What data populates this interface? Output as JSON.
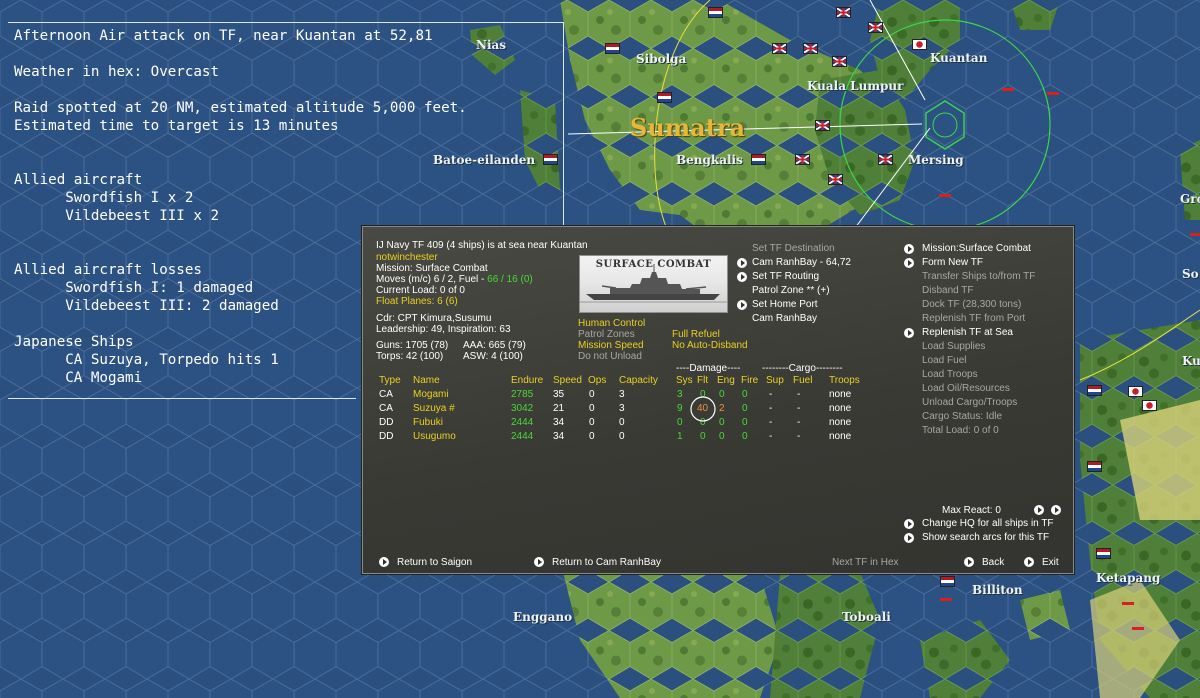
{
  "map": {
    "labels": {
      "nias": "Nias",
      "sibolga": "Sibolga",
      "kuala_lumpur": "Kuala Lumpur",
      "kuantan": "Kuantan",
      "sumatra": "Sumatra",
      "batoe_eilanden": "Batoe-eilanden",
      "bengkalis": "Bengkalis",
      "mersing": "Mersing",
      "gro": "Gro",
      "so": "So",
      "ku": "Ku",
      "enggano": "Enggano",
      "toboali": "Toboali",
      "billiton": "Billiton",
      "ketapang": "Ketapang"
    }
  },
  "combat_report": {
    "lines": [
      "Afternoon Air attack on TF, near Kuantan at 52,81",
      "Weather in hex: Overcast",
      "Raid spotted at 20 NM, estimated altitude 5,000 feet.",
      "Estimated time to target is 13 minutes",
      "Allied aircraft",
      "      Swordfish I x 2",
      "      Vildebeest III x 2",
      "Allied aircraft losses",
      "      Swordfish I: 1 damaged",
      "      Vildebeest III: 2 damaged",
      "Japanese Ships",
      "      CA Suzuya, Torpedo hits 1",
      "      CA Mogami"
    ]
  },
  "tf": {
    "header": "IJ Navy TF 409 (4 ships) is at sea near Kuantan",
    "player": "notwinchester",
    "mission": "Mission: Surface Combat",
    "moves_prefix": "Moves (m/c) 6 / 2, Fuel - ",
    "fuel": "66 / 16 (0)",
    "current_load": "Current Load: 0 of 0",
    "float_planes": "Float Planes: 6 (6)",
    "cdr": "Cdr: CPT Kimura,Susumu",
    "leadership": "Leadership: 49, Inspiration: 63",
    "guns": "Guns: 1705 (78)",
    "aaa": "AAA: 665 (79)",
    "torps": "Torps: 42 (100)",
    "asw": "ASW: 4 (100)",
    "image_caption": "SURFACE COMBAT",
    "human_control": "Human Control",
    "patrol_zones": "Patrol Zones",
    "full_refuel": "Full Refuel",
    "mission_speed": "Mission Speed",
    "no_auto_disband": "No Auto-Disband",
    "do_not_unload": "Do not Unload",
    "mid_options": {
      "set_tf_destination": "Set TF Destination",
      "cam_ranh_bay_dest": "Cam RanhBay - 64,72",
      "set_tf_routing": "Set TF Routing",
      "patrol_zone": "Patrol Zone ** (+)",
      "set_home_port": "Set Home Port",
      "cam_ranh_bay_home": "Cam RanhBay"
    },
    "right_options": {
      "mission_surface_combat": "Mission:Surface Combat",
      "form_new_tf": "Form New TF",
      "transfer_ships": "Transfer Ships to/from TF",
      "disband_tf": "Disband TF",
      "dock_tf": "Dock TF (28,300 tons)",
      "replenish_port": "Replenish TF from Port",
      "replenish_sea": "Replenish TF at Sea",
      "load_supplies": "Load Supplies",
      "load_fuel": "Load Fuel",
      "load_troops": "Load Troops",
      "load_oil": "Load Oil/Resources",
      "unload_cargo": "Unload Cargo/Troops",
      "cargo_status": "Cargo Status: Idle",
      "total_load": "Total Load: 0 of 0"
    },
    "group_headers": {
      "damage": "----Damage----",
      "cargo": "--------Cargo--------"
    },
    "columns": [
      "Type",
      "Name",
      "Endure",
      "Speed",
      "Ops",
      "Capacity",
      "Sys",
      "Flt",
      "Eng",
      "Fire",
      "Sup",
      "Fuel",
      "Troops"
    ],
    "ships": [
      {
        "type": "CA",
        "name": "Mogami",
        "endure": "2785",
        "speed": "35",
        "ops": "0",
        "capacity": "3",
        "sys": "3",
        "flt": "0",
        "eng": "0",
        "fire": "0",
        "sup": "-",
        "fuel": "-",
        "troops": "none"
      },
      {
        "type": "CA",
        "name": "Suzuya #",
        "endure": "3042",
        "speed": "21",
        "ops": "0",
        "capacity": "3",
        "sys": "9",
        "flt": "40",
        "eng": "2",
        "fire": "0",
        "sup": "-",
        "fuel": "-",
        "troops": "none"
      },
      {
        "type": "DD",
        "name": "Fubuki",
        "endure": "2444",
        "speed": "34",
        "ops": "0",
        "capacity": "0",
        "sys": "0",
        "flt": "0",
        "eng": "0",
        "fire": "0",
        "sup": "-",
        "fuel": "-",
        "troops": "none"
      },
      {
        "type": "DD",
        "name": "Usugumo",
        "endure": "2444",
        "speed": "34",
        "ops": "0",
        "capacity": "0",
        "sys": "1",
        "flt": "0",
        "eng": "0",
        "fire": "0",
        "sup": "-",
        "fuel": "-",
        "troops": "none"
      }
    ],
    "max_react": "Max React: 0",
    "change_hq": "Change HQ for all ships in TF",
    "show_search_arcs": "Show search arcs for this TF",
    "footer": {
      "return_saigon": "Return to Saigon",
      "return_cam_ranh": "Return to Cam RanhBay",
      "next_tf": "Next TF in Hex",
      "back": "Back",
      "exit": "Exit"
    }
  }
}
